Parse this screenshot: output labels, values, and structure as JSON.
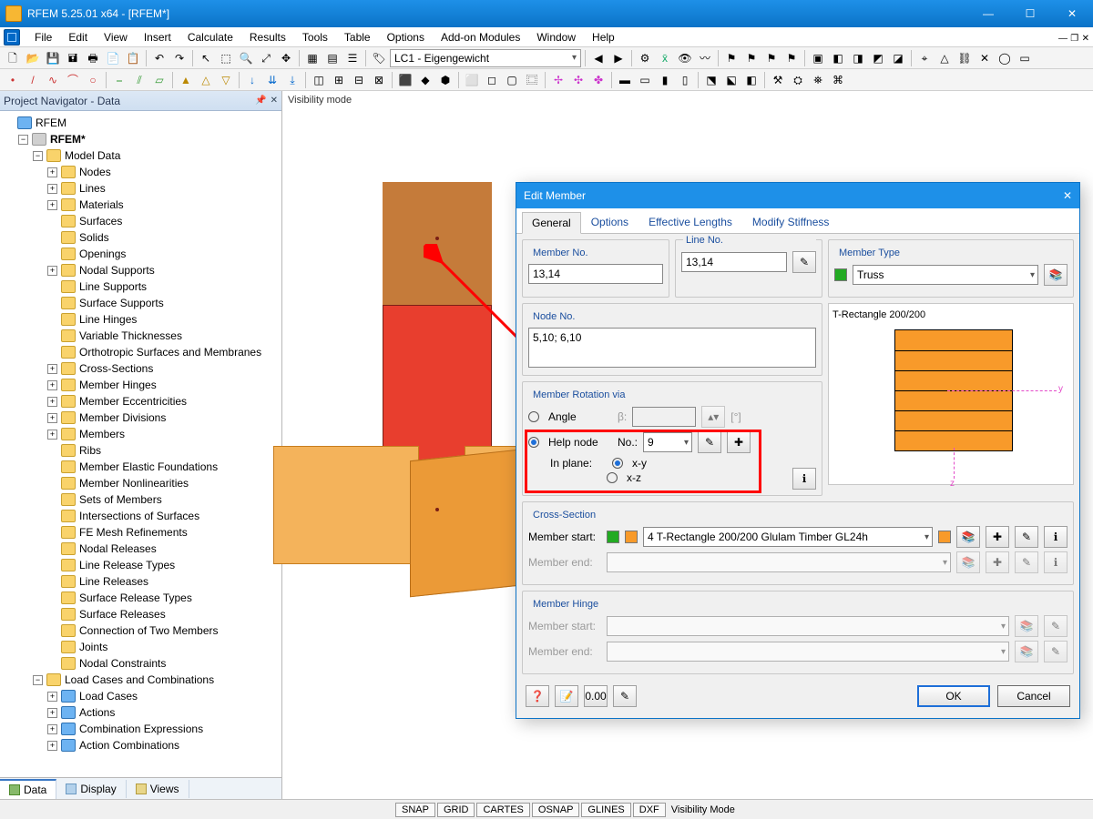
{
  "titlebar": {
    "title": "RFEM 5.25.01 x64 - [RFEM*]"
  },
  "window_buttons": {
    "min": "—",
    "max": "☐",
    "close": "✕"
  },
  "menubar": {
    "items": [
      "File",
      "Edit",
      "View",
      "Insert",
      "Calculate",
      "Results",
      "Tools",
      "Table",
      "Options",
      "Add-on Modules",
      "Window",
      "Help"
    ]
  },
  "toolbar1": {
    "loadcase": "LC1 - Eigengewicht"
  },
  "navigator": {
    "title": "Project Navigator - Data",
    "root": "RFEM",
    "project": "RFEM*",
    "model_data": "Model Data",
    "items": [
      "Nodes",
      "Lines",
      "Materials",
      "Surfaces",
      "Solids",
      "Openings",
      "Nodal Supports",
      "Line Supports",
      "Surface Supports",
      "Line Hinges",
      "Variable Thicknesses",
      "Orthotropic Surfaces and Membranes",
      "Cross-Sections",
      "Member Hinges",
      "Member Eccentricities",
      "Member Divisions",
      "Members",
      "Ribs",
      "Member Elastic Foundations",
      "Member Nonlinearities",
      "Sets of Members",
      "Intersections of Surfaces",
      "FE Mesh Refinements",
      "Nodal Releases",
      "Line Release Types",
      "Line Releases",
      "Surface Release Types",
      "Surface Releases",
      "Connection of Two Members",
      "Joints",
      "Nodal Constraints"
    ],
    "loadcases_group": "Load Cases and Combinations",
    "lc_items": [
      "Load Cases",
      "Actions",
      "Combination Expressions",
      "Action Combinations"
    ],
    "tabs": [
      "Data",
      "Display",
      "Views"
    ]
  },
  "viewport": {
    "mode_label": "Visibility mode"
  },
  "dialog": {
    "title": "Edit Member",
    "tabs": [
      "General",
      "Options",
      "Effective Lengths",
      "Modify Stiffness"
    ],
    "member_no": {
      "legend": "Member No.",
      "value": "13,14"
    },
    "line_no": {
      "legend": "Line No.",
      "value": "13,14"
    },
    "member_type": {
      "legend": "Member Type",
      "value": "Truss"
    },
    "node_no": {
      "legend": "Node No.",
      "value": "5,10; 6,10"
    },
    "rotation": {
      "legend": "Member Rotation via",
      "angle_label": "Angle",
      "beta_label": "β:",
      "beta_unit": "[°]",
      "helpnode_label": "Help node",
      "no_label": "No.:",
      "no_value": "9",
      "inplane_label": "In plane:",
      "opt_xy": "x-y",
      "opt_xz": "x-z"
    },
    "preview": {
      "title": "T-Rectangle 200/200",
      "y": "y",
      "z": "z"
    },
    "cross_section": {
      "legend": "Cross-Section",
      "start_label": "Member start:",
      "end_label": "Member end:",
      "start_value": "4   T-Rectangle 200/200   Glulam Timber GL24h"
    },
    "hinge": {
      "legend": "Member Hinge",
      "start_label": "Member start:",
      "end_label": "Member end:"
    },
    "footer": {
      "ok": "OK",
      "cancel": "Cancel"
    }
  },
  "statusbar": {
    "items": [
      "SNAP",
      "GRID",
      "CARTES",
      "OSNAP",
      "GLINES",
      "DXF"
    ],
    "mode": "Visibility Mode"
  }
}
